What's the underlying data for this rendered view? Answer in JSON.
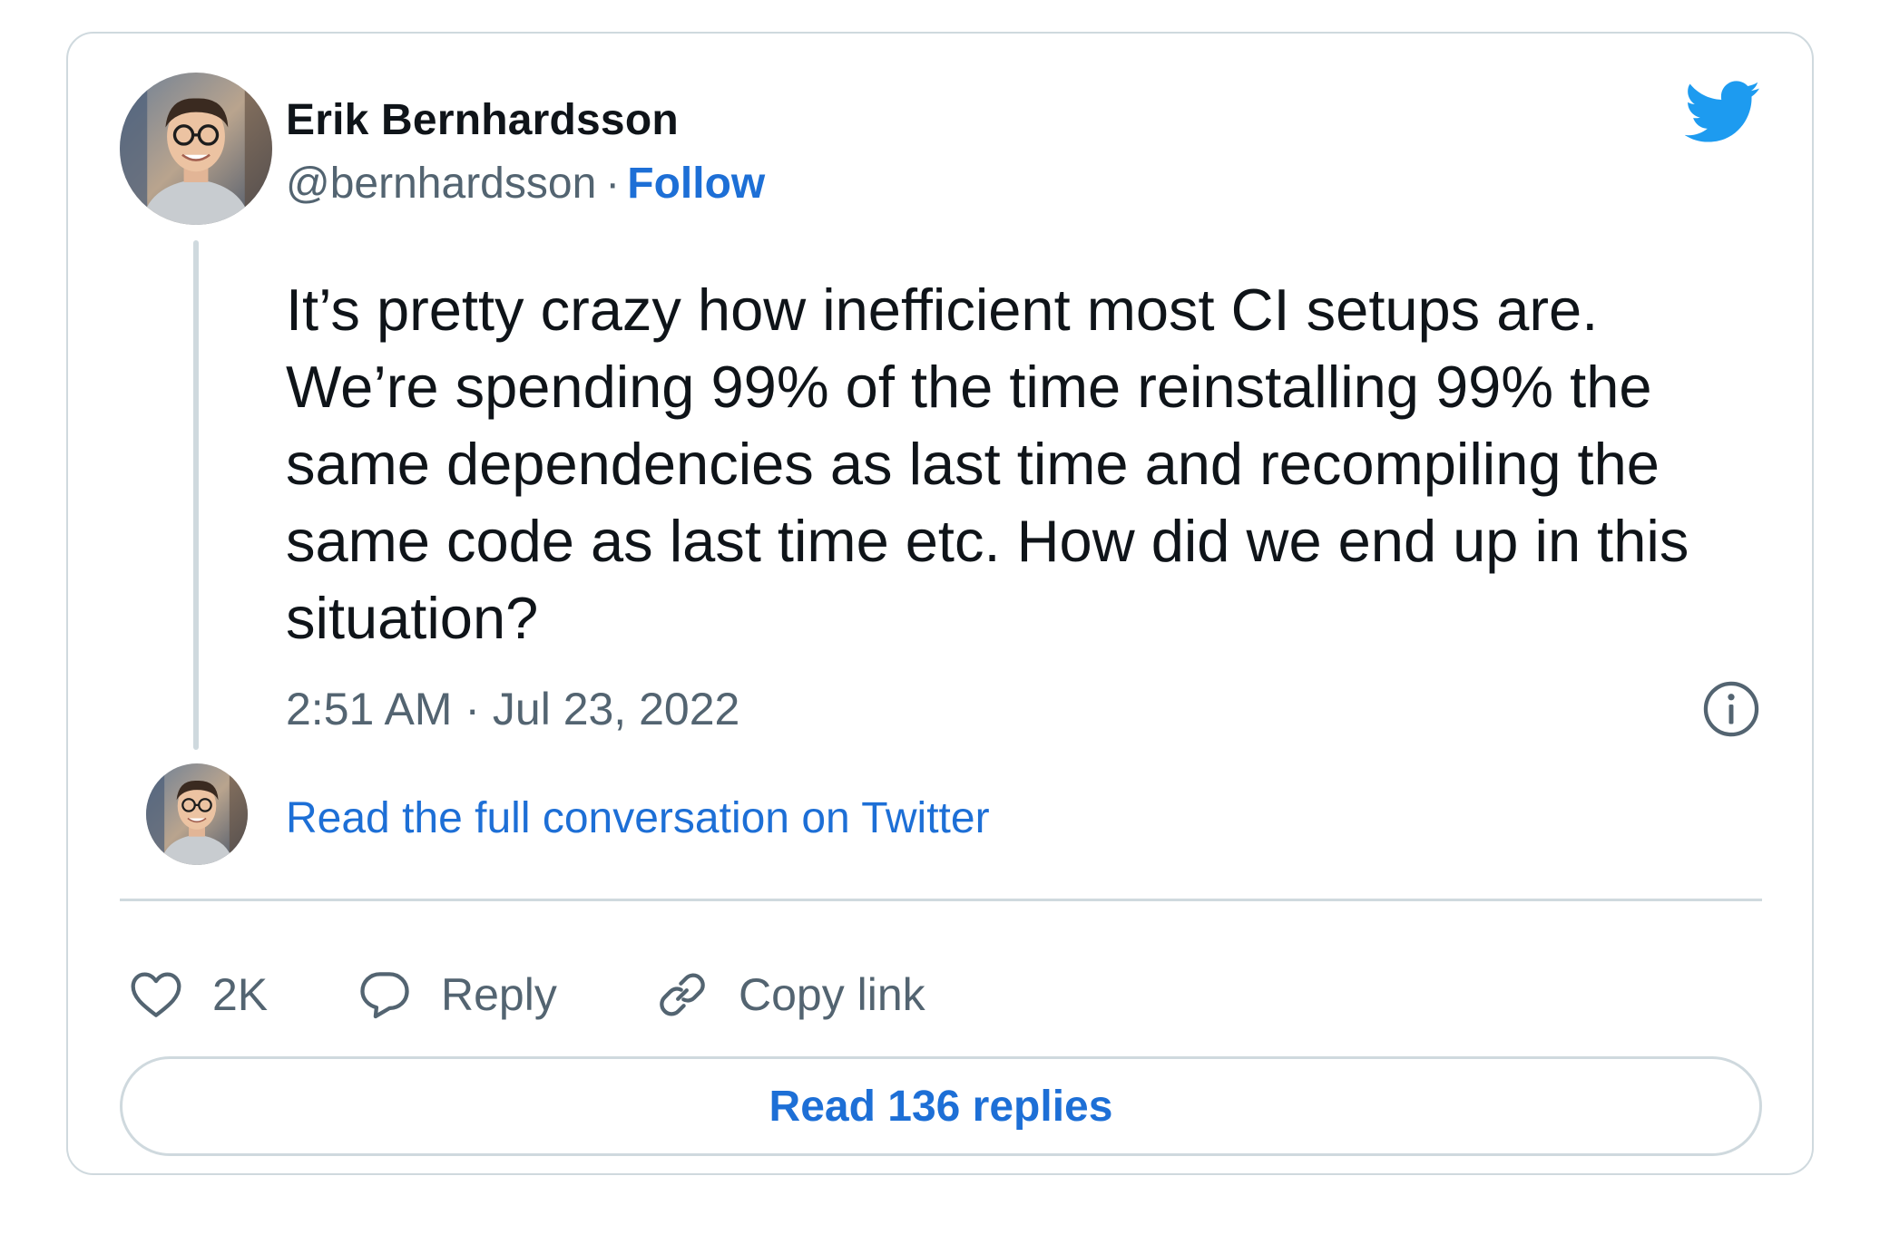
{
  "author": {
    "name": "Erik Bernhardsson",
    "handle": "@bernhardsson",
    "separator": "·",
    "follow_label": "Follow"
  },
  "tweet": {
    "text": "It’s pretty crazy how inefficient most CI setups are.\nWe’re spending 99% of the time reinstalling 99% the\nsame dependencies as last time and recompiling the\nsame code as last time etc. How did we end up in this\nsituation?",
    "timestamp": "2:51 AM · Jul 23, 2022"
  },
  "conversation_link": "Read the full conversation on Twitter",
  "actions": {
    "like_count": "2K",
    "reply_label": "Reply",
    "copy_link_label": "Copy link"
  },
  "replies_button": "Read 136 replies",
  "icons": {
    "brand": "twitter-bird-icon",
    "info": "info-icon",
    "like": "heart-icon",
    "reply": "speech-bubble-icon",
    "copy": "link-icon"
  },
  "colors": {
    "accent": "#1d6fd6",
    "twitter_blue": "#1d9bf0",
    "text": "#0f1419",
    "secondary_text": "#536471",
    "border": "#cfd9de"
  }
}
